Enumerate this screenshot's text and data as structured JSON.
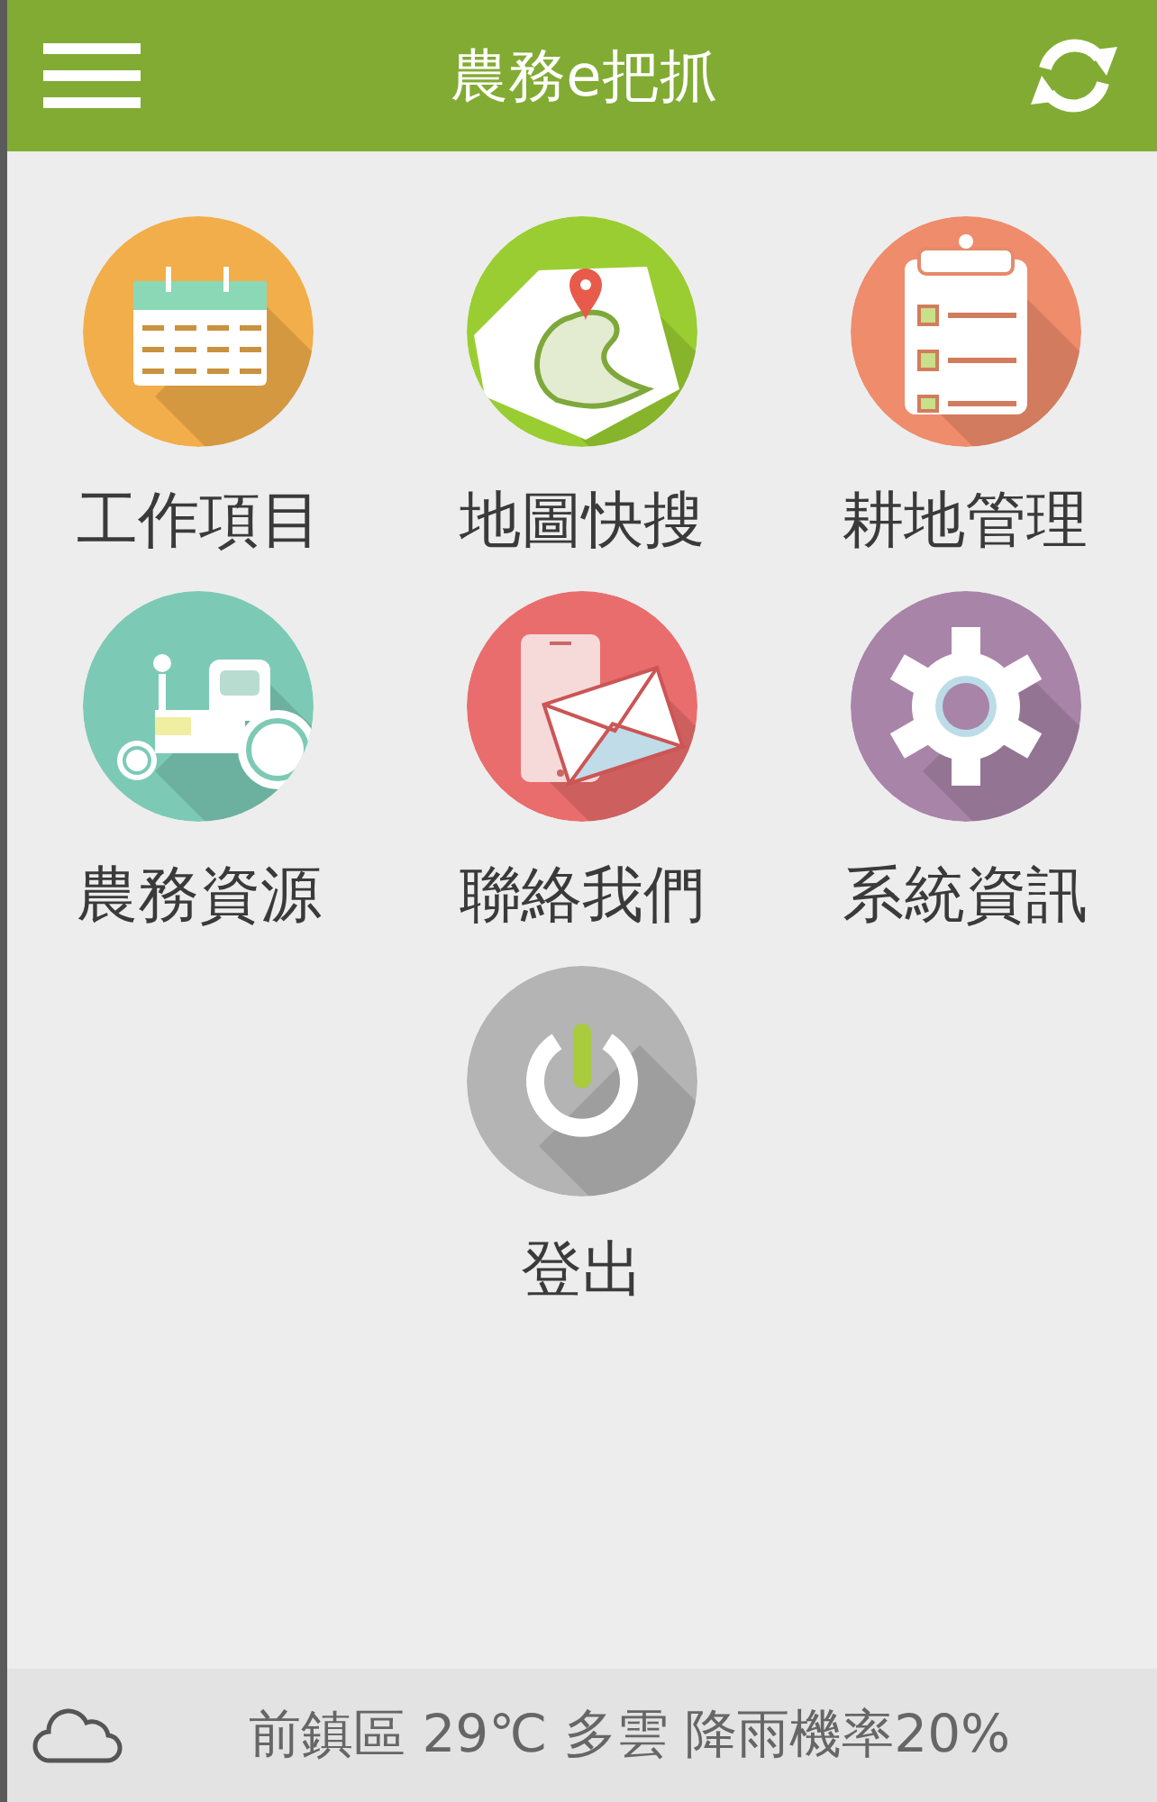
{
  "header": {
    "title": "農務e把抓"
  },
  "menu_items": [
    {
      "label": "工作項目",
      "kind": "calendar",
      "color": "#f2ae4a"
    },
    {
      "label": "地圖快搜",
      "kind": "map",
      "color": "#9acd32"
    },
    {
      "label": "耕地管理",
      "kind": "clipboard",
      "color": "#ef8c6c"
    },
    {
      "label": "農務資源",
      "kind": "tractor",
      "color": "#7ccab5"
    },
    {
      "label": "聯絡我們",
      "kind": "mail",
      "color": "#ea6d6d"
    },
    {
      "label": "系統資訊",
      "kind": "gear",
      "color": "#a884a8"
    },
    {
      "label": "登出",
      "kind": "power",
      "color": "#b4b4b4"
    }
  ],
  "weather": {
    "text": "前鎮區 29℃ 多雲 降雨機率20%"
  }
}
